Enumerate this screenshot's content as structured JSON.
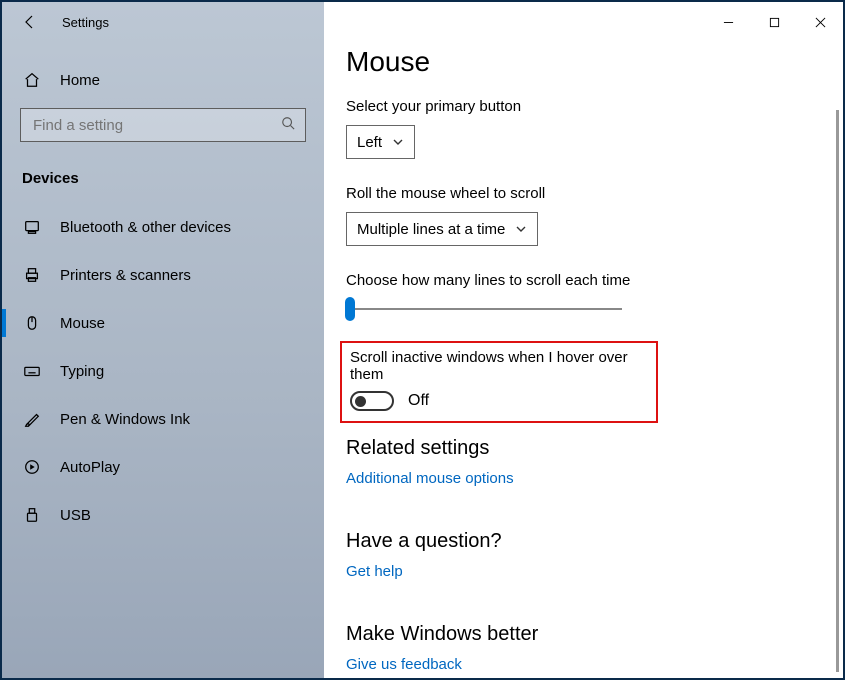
{
  "window": {
    "title": "Settings"
  },
  "sidebar": {
    "home_label": "Home",
    "search_placeholder": "Find a setting",
    "category_label": "Devices",
    "items": [
      {
        "label": "Bluetooth & other devices",
        "icon": "bluetooth",
        "active": false
      },
      {
        "label": "Printers & scanners",
        "icon": "printer",
        "active": false
      },
      {
        "label": "Mouse",
        "icon": "mouse",
        "active": true
      },
      {
        "label": "Typing",
        "icon": "keyboard",
        "active": false
      },
      {
        "label": "Pen & Windows Ink",
        "icon": "pen",
        "active": false
      },
      {
        "label": "AutoPlay",
        "icon": "autoplay",
        "active": false
      },
      {
        "label": "USB",
        "icon": "usb",
        "active": false
      }
    ]
  },
  "main": {
    "title": "Mouse",
    "primary_button_label": "Select your primary button",
    "primary_button_value": "Left",
    "scroll_wheel_label": "Roll the mouse wheel to scroll",
    "scroll_wheel_value": "Multiple lines at a time",
    "lines_label": "Choose how many lines to scroll each time",
    "inactive_windows_label": "Scroll inactive windows when I hover over them",
    "inactive_windows_value": "Off",
    "related_heading": "Related settings",
    "related_link": "Additional mouse options",
    "question_heading": "Have a question?",
    "question_link": "Get help",
    "improve_heading": "Make Windows better",
    "improve_link": "Give us feedback"
  },
  "colors": {
    "accent": "#0078d4",
    "link": "#0067c0",
    "highlight_border": "#d11"
  }
}
